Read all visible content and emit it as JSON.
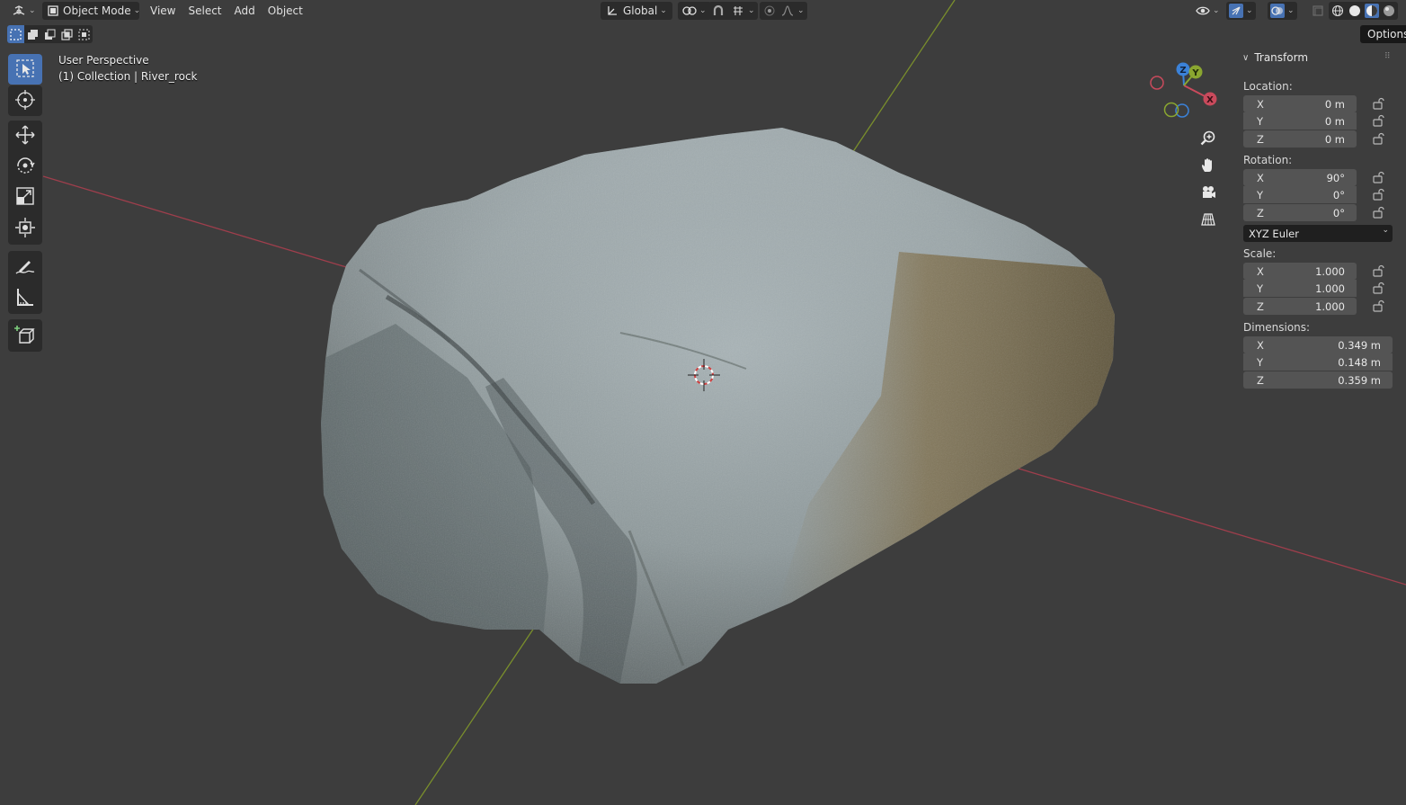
{
  "header": {
    "editor_type_icon": "grid-3d-icon",
    "mode": {
      "label": "Object Mode",
      "icon": "object-mode-icon"
    },
    "menus": [
      {
        "label": "View"
      },
      {
        "label": "Select"
      },
      {
        "label": "Add"
      },
      {
        "label": "Object"
      }
    ],
    "transform_orientation": {
      "label": "Global",
      "icon": "orientation-axes-icon"
    },
    "pivot_icon": "pivot-point-icon",
    "snap_icon": "magnet-icon",
    "snap_target_icon": "snap-increment-icon",
    "proportional_icon": "proportional-editing-icon",
    "falloff_icon": "falloff-curve-icon",
    "right_icons": [
      "visibility-eye-icon",
      "gizmo-icon",
      "overlay-icon",
      "xray-icon"
    ],
    "shading_modes": [
      "wireframe",
      "solid",
      "material-preview",
      "rendered"
    ],
    "active_shading": "material-preview"
  },
  "select_modes": [
    "select-new",
    "select-extend",
    "select-subtract",
    "select-difference",
    "select-intersect"
  ],
  "toolbar": {
    "tools": [
      {
        "name": "select-box",
        "icon": "select-box-icon",
        "active": true
      },
      {
        "name": "cursor",
        "icon": "cursor-icon"
      },
      {
        "name": "move",
        "icon": "move-icon"
      },
      {
        "name": "rotate",
        "icon": "rotate-icon"
      },
      {
        "name": "scale",
        "icon": "scale-icon"
      },
      {
        "name": "transform",
        "icon": "transform-icon"
      },
      {
        "name": "annotate",
        "icon": "annotate-icon"
      },
      {
        "name": "measure",
        "icon": "measure-icon"
      },
      {
        "name": "add-cube",
        "icon": "add-cube-icon"
      }
    ]
  },
  "viewport": {
    "view_name": "User Perspective",
    "collection_info": "(1) Collection | River_rock",
    "axis_colors": {
      "x": "#c94a5c",
      "y": "#8aa630",
      "z": "#3b82d9"
    },
    "gizmo_labels": {
      "x": "X",
      "y": "Y",
      "z": "Z"
    }
  },
  "nav_buttons": [
    "zoom-icon",
    "pan-hand-icon",
    "camera-icon",
    "perspective-grid-icon"
  ],
  "tooltip": {
    "label": "Options"
  },
  "sidebar": {
    "panel_title": "Transform",
    "location": {
      "label": "Location:",
      "x": {
        "axis": "X",
        "value": "0 m"
      },
      "y": {
        "axis": "Y",
        "value": "0 m"
      },
      "z": {
        "axis": "Z",
        "value": "0 m"
      }
    },
    "rotation": {
      "label": "Rotation:",
      "x": {
        "axis": "X",
        "value": "90°"
      },
      "y": {
        "axis": "Y",
        "value": "0°"
      },
      "z": {
        "axis": "Z",
        "value": "0°"
      },
      "mode": "XYZ Euler"
    },
    "scale": {
      "label": "Scale:",
      "x": {
        "axis": "X",
        "value": "1.000"
      },
      "y": {
        "axis": "Y",
        "value": "1.000"
      },
      "z": {
        "axis": "Z",
        "value": "1.000"
      }
    },
    "dimensions": {
      "label": "Dimensions:",
      "x": {
        "axis": "X",
        "value": "0.349 m"
      },
      "y": {
        "axis": "Y",
        "value": "0.148 m"
      },
      "z": {
        "axis": "Z",
        "value": "0.359 m"
      }
    }
  }
}
